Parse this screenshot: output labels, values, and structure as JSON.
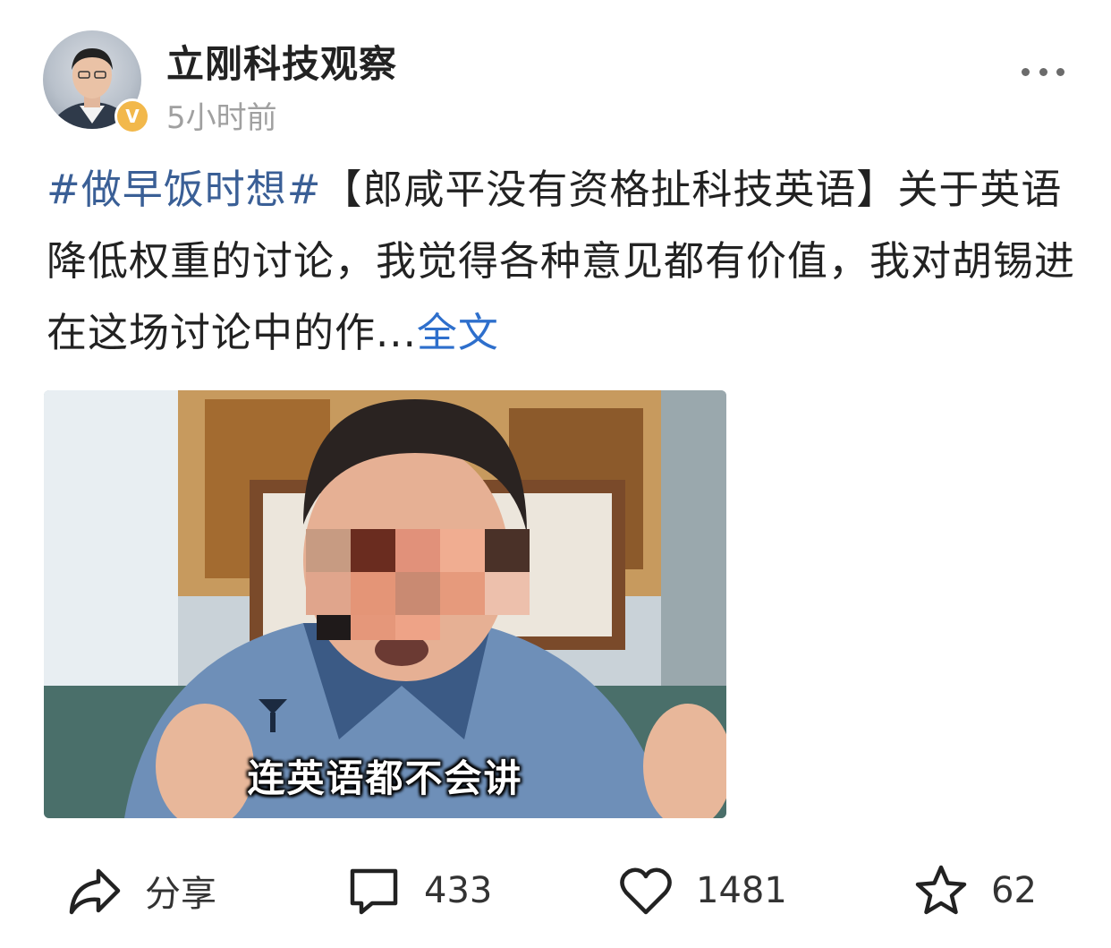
{
  "post": {
    "author": "立刚科技观察",
    "time": "5小时前",
    "verified_badge": "V",
    "hashtag": "#做早饭时想#",
    "text_main": "【郎咸平没有资格扯科技英语】关于英语降低权重的讨论，我觉得各种意见都有价值，我对胡锡进在这场讨论中的作...",
    "full_text_link": "全文",
    "image_caption": "连英语都不会讲"
  },
  "actions": {
    "share_label": "分享",
    "comment_count": "433",
    "like_count": "1481",
    "favorite_count": "62"
  },
  "icons": [
    "more-icon",
    "verified-icon",
    "share-icon",
    "comment-icon",
    "like-icon",
    "star-icon"
  ],
  "colors": {
    "hashtag": "#3a5f96",
    "link": "#2e6fcc",
    "badge": "#f2b84b",
    "meta": "#a0a0a0"
  }
}
